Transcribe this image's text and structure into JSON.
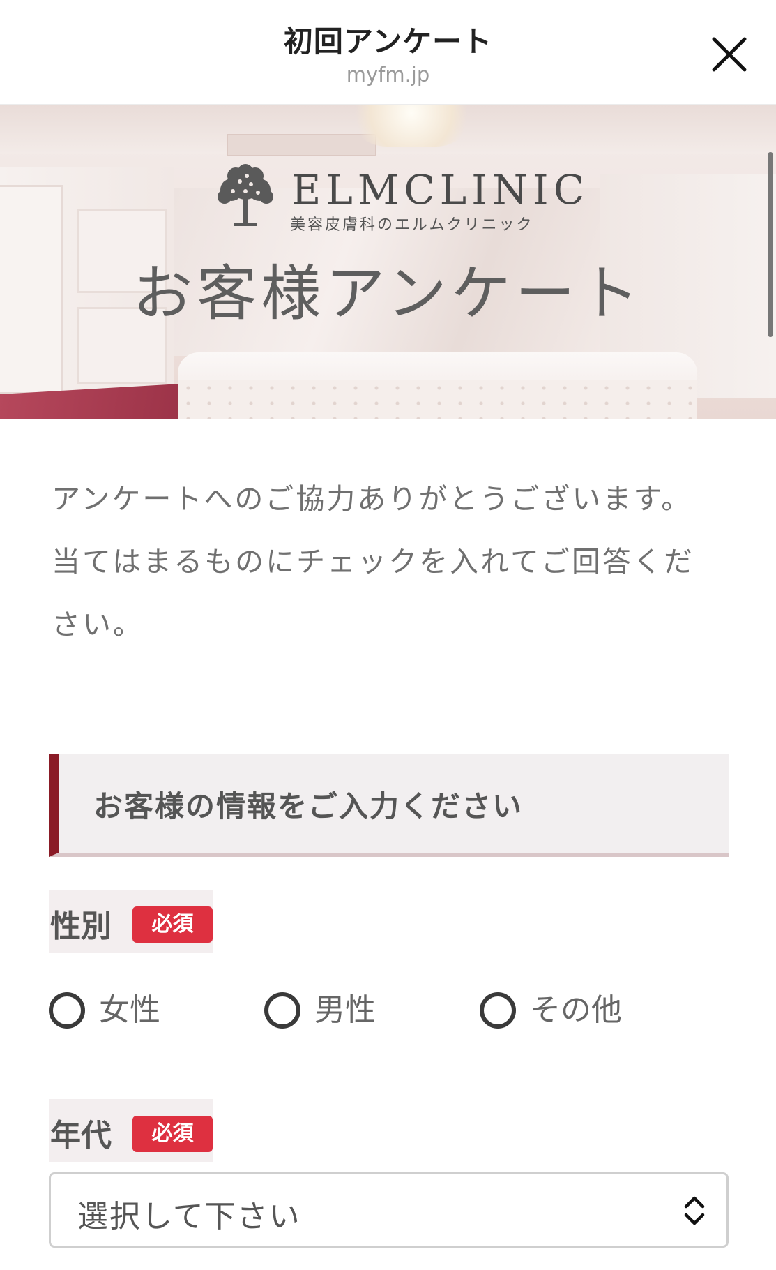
{
  "header": {
    "title": "初回アンケート",
    "domain": "myfm.jp"
  },
  "hero": {
    "brand_name": "ELMCLINIC",
    "brand_sub": "美容皮膚科のエルムクリニック",
    "title": "お客様アンケート"
  },
  "intro": {
    "line1": "アンケートへのご協力ありがとうございます。",
    "line2": "当てはまるものにチェックを入れてご回答ください。"
  },
  "section": {
    "title": "お客様の情報をご入力ください"
  },
  "fields": {
    "gender": {
      "label": "性別",
      "required": "必須",
      "options": [
        "女性",
        "男性",
        "その他"
      ]
    },
    "age": {
      "label": "年代",
      "required": "必須",
      "selected": "選択して下さい"
    }
  },
  "icons": {
    "close": "close-icon",
    "tree": "tree-icon",
    "select": "chevron-up-down-icon"
  },
  "colors": {
    "accent": "#8a1b26",
    "required": "#de3040"
  }
}
